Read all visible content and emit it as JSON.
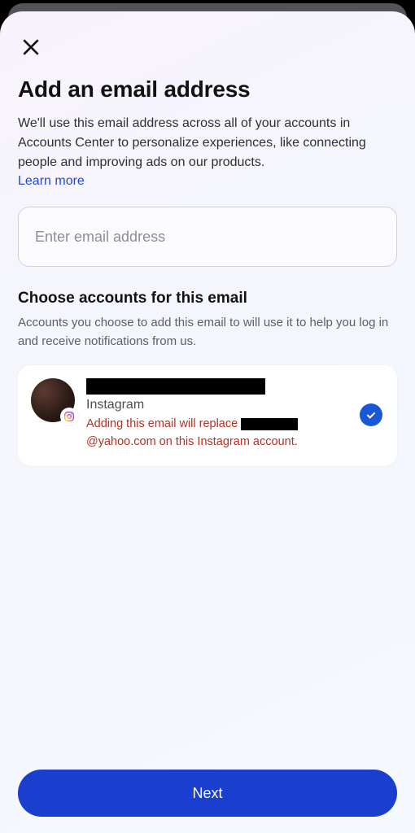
{
  "header": {
    "title": "Add an email address",
    "description": "We'll use this email address across all of your accounts in Accounts Center to personalize experiences, like connecting people and improving ads on our products.",
    "learn_more": "Learn more"
  },
  "email_input": {
    "placeholder": "Enter email address",
    "value": ""
  },
  "accounts_section": {
    "title": "Choose accounts for this email",
    "description": "Accounts you choose to add this email to will use it to help you log in and receive notifications from us."
  },
  "account": {
    "name_redacted": true,
    "platform": "Instagram",
    "warning_prefix": "Adding this email will replace ",
    "warning_email_domain": "@yahoo.com",
    "warning_suffix": " on this Instagram account.",
    "selected": true
  },
  "footer": {
    "next_label": "Next"
  }
}
